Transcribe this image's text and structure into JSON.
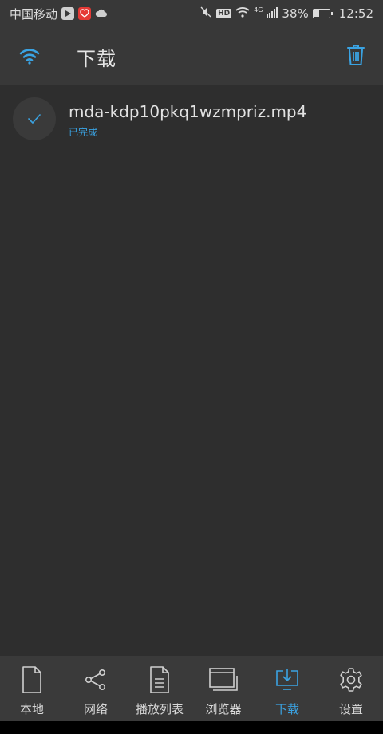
{
  "status_bar": {
    "carrier": "中国移动",
    "signal_label": "4G",
    "hd_label": "HD",
    "battery_percent": "38%",
    "battery_level": 0.38,
    "time": "12:52"
  },
  "header": {
    "title": "下载",
    "left_icon": "wifi-icon",
    "right_icon": "trash-icon"
  },
  "downloads": [
    {
      "file_name": "mda-kdp10pkq1wzmpriz.mp4",
      "status": "已完成"
    }
  ],
  "bottom_nav": {
    "items": [
      {
        "label": "本地",
        "icon": "file-icon"
      },
      {
        "label": "网络",
        "icon": "share-icon"
      },
      {
        "label": "播放列表",
        "icon": "playlist-icon"
      },
      {
        "label": "浏览器",
        "icon": "browser-icon"
      },
      {
        "label": "下载",
        "icon": "download-icon"
      },
      {
        "label": "设置",
        "icon": "gear-icon"
      }
    ],
    "active_index": 4
  },
  "colors": {
    "accent": "#3aa3e3",
    "background": "#2e2e2e",
    "header": "#383838",
    "nav": "#3a3a3a"
  }
}
